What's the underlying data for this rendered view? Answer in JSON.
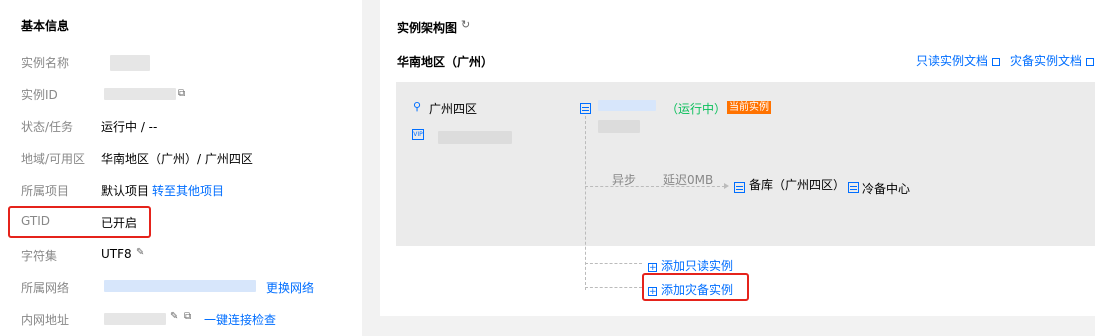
{
  "basic_info": {
    "title": "基本信息",
    "rows": {
      "name": {
        "label": "实例名称"
      },
      "id": {
        "label": "实例ID"
      },
      "status": {
        "label": "状态/任务",
        "value": "运行中 / --"
      },
      "region": {
        "label": "地域/可用区",
        "value": "华南地区（广州）/ 广州四区"
      },
      "project": {
        "label": "所属项目",
        "value": "默认项目",
        "link": "转至其他项目"
      },
      "gtid": {
        "label": "GTID",
        "value": "已开启"
      },
      "charset": {
        "label": "字符集",
        "value": "UTF8"
      },
      "network": {
        "label": "所属网络",
        "link": "更换网络"
      },
      "intranet": {
        "label": "内网地址",
        "link": "一键连接检查"
      }
    }
  },
  "architecture": {
    "title": "实例架构图",
    "region_title": "华南地区（广州）",
    "doc_links": {
      "readonly": "只读实例文档",
      "disaster": "灾备实例文档"
    },
    "zone": "广州四区",
    "status": "（运行中）",
    "current_badge": "当前实例",
    "vip": "VIP",
    "sync": {
      "mode": "异步",
      "delay": "延迟0MB"
    },
    "backup_db": "备库（广州四区）",
    "cold_backup": "冷备中心",
    "add_readonly": "添加只读实例",
    "add_disaster": "添加灾备实例"
  },
  "colors": {
    "accent": "#006eff",
    "running": "#0abf5b",
    "badge": "#ff7200",
    "highlight": "#e5231b"
  }
}
